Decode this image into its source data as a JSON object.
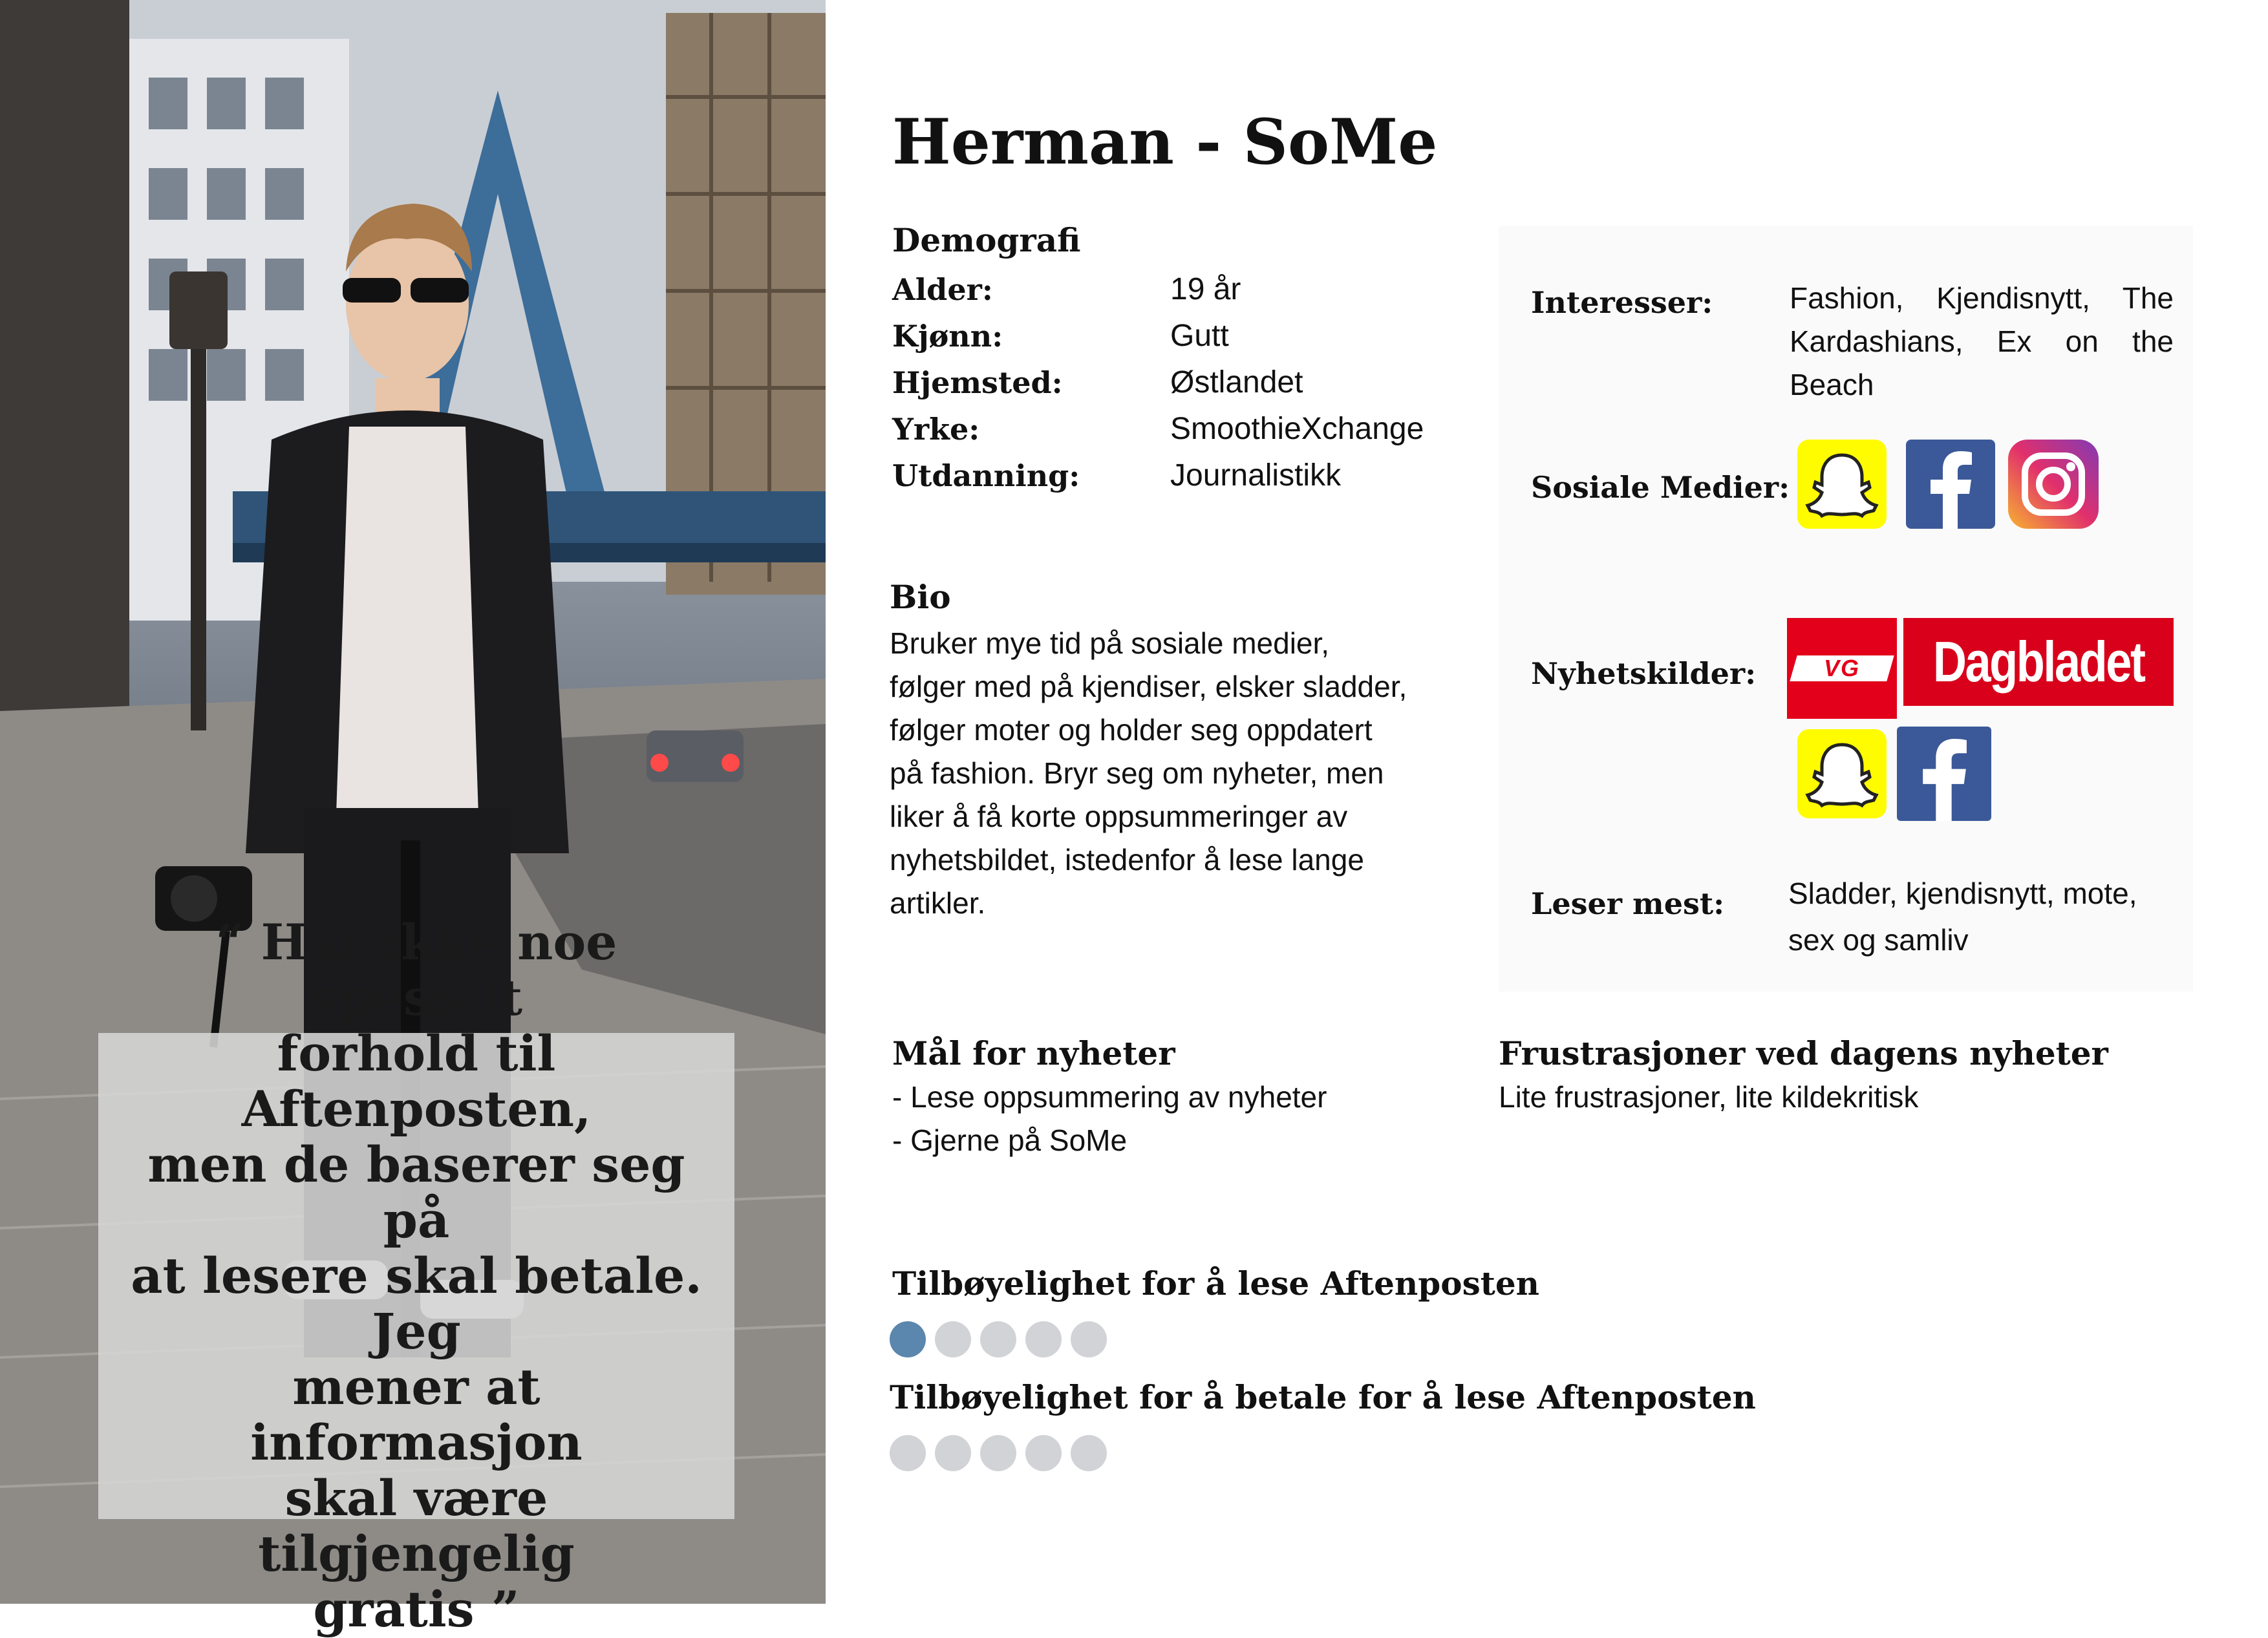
{
  "title": "Herman - SoMe",
  "demografi": {
    "heading": "Demografi",
    "rows": [
      {
        "label": "Alder:",
        "value": "19 år"
      },
      {
        "label": "Kjønn:",
        "value": "Gutt"
      },
      {
        "label": "Hjemsted:",
        "value": "Østlandet"
      },
      {
        "label": "Yrke:",
        "value": "SmoothieXchange"
      },
      {
        "label": "Utdanning:",
        "value": "Journalistikk"
      }
    ]
  },
  "bio": {
    "heading": "Bio",
    "lines": [
      "Bruker mye tid på sosiale medier,",
      "følger med på kjendiser, elsker sladder,",
      "følger moter og holder seg oppdatert",
      "på fashion. Bryr seg om nyheter, men",
      "liker å få korte oppsummeringer av",
      "nyhetsbildet, istedenfor å lese lange",
      "artikler."
    ]
  },
  "interesser": {
    "label": "Interesser:",
    "lines": [
      "Fashion, Kjendisnytt, The",
      "Kardashians, Ex on the",
      "Beach"
    ]
  },
  "sosiale_medier": {
    "label": "Sosiale Medier:",
    "icons": [
      "snapchat-icon",
      "facebook-icon",
      "instagram-icon"
    ]
  },
  "nyhetskilder": {
    "label": "Nyhetskilder:",
    "vg": "VG",
    "dagbladet": "Dagbladet",
    "icons": [
      "snapchat-icon",
      "facebook-icon"
    ]
  },
  "leser_mest": {
    "label": "Leser mest:",
    "lines": [
      "Sladder, kjendisnytt, mote,",
      "sex og samliv"
    ]
  },
  "maal": {
    "heading": "Mål for nyheter",
    "lines": [
      "- Lese oppsummering av nyheter",
      "- Gjerne på SoMe"
    ]
  },
  "frustrasjoner": {
    "heading": "Frustrasjoner ved dagens nyheter",
    "text": "Lite frustrasjoner, lite kildekritisk"
  },
  "ratings": [
    {
      "label": "Tilbøyelighet for å lese Aftenposten",
      "value": 1,
      "max": 5
    },
    {
      "label": "Tilbøyelighet for å betale for å lese Aftenposten",
      "value": 0,
      "max": 5
    }
  ],
  "quote": {
    "lines": [
      "“ Har ikke noe spesielt",
      "forhold til Aftenposten,",
      "men de baserer seg på",
      "at lesere skal betale. Jeg",
      "mener at informasjon",
      "skal være tilgjengelig",
      "gratis ”"
    ]
  },
  "colors": {
    "accent_dot": "#5b86ad",
    "inactive_dot": "#d2d3d6",
    "snapchat": "#fffc00",
    "facebook": "#3b5998",
    "vg_red": "#e2001a",
    "dagbladet_red": "#d9001b"
  }
}
